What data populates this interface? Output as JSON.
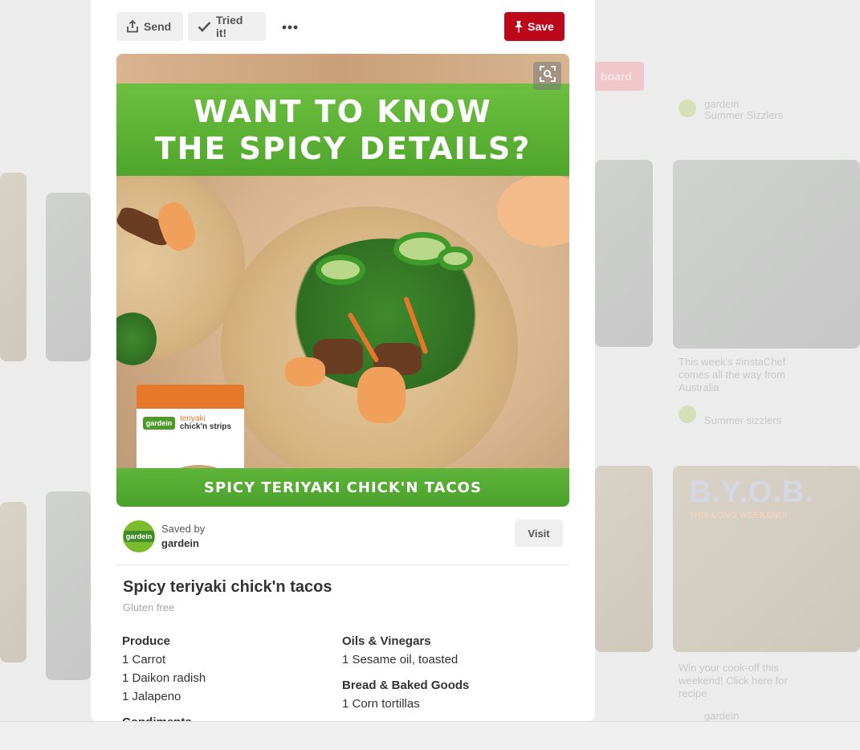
{
  "toolbar": {
    "send_label": "Send",
    "tried_label": "Tried it!",
    "more_label": "•••",
    "save_label": "Save"
  },
  "background": {
    "save_board_label": "board",
    "byob_text": "B.Y.O.B.",
    "byob_sub": "THIS LONG WEEKEND!",
    "snippets": [
      {
        "text": "gardein",
        "sub": "Summer Sizzlers"
      },
      {
        "text": "This week's #instaChef comes all the way from Australia",
        "sub": "Summer sizzlers"
      },
      {
        "text": "Win your cook-off this weekend! Click here for recipe",
        "sub": "gardein"
      }
    ]
  },
  "hero": {
    "headline_line1": "WANT TO KNOW",
    "headline_line2": "THE SPICY DETAILS?",
    "footer_text": "SPICY TERIYAKI CHICK'N TACOS",
    "package_brand": "gardein",
    "package_name": "chick'n strips",
    "package_flavor": "teriyaki"
  },
  "saved_by": {
    "label": "Saved by",
    "user": "gardein",
    "avatar_text": "gardein",
    "visit_label": "Visit"
  },
  "recipe": {
    "title": "Spicy teriyaki chick'n tacos",
    "subtitle": "Gluten free",
    "left_groups": [
      {
        "heading": "Produce",
        "items": [
          "1 Carrot",
          "1 Daikon radish",
          "1 Jalapeno"
        ]
      },
      {
        "heading": "Condiments",
        "items": []
      }
    ],
    "right_groups": [
      {
        "heading": "Oils & Vinegars",
        "items": [
          "1 Sesame oil, toasted"
        ]
      },
      {
        "heading": "Bread & Baked Goods",
        "items": [
          "1 Corn tortillas"
        ]
      }
    ]
  },
  "colors": {
    "save_red": "#bd081c",
    "banner_green": "#5fb43a",
    "avatar_green": "#7bbb2c"
  }
}
